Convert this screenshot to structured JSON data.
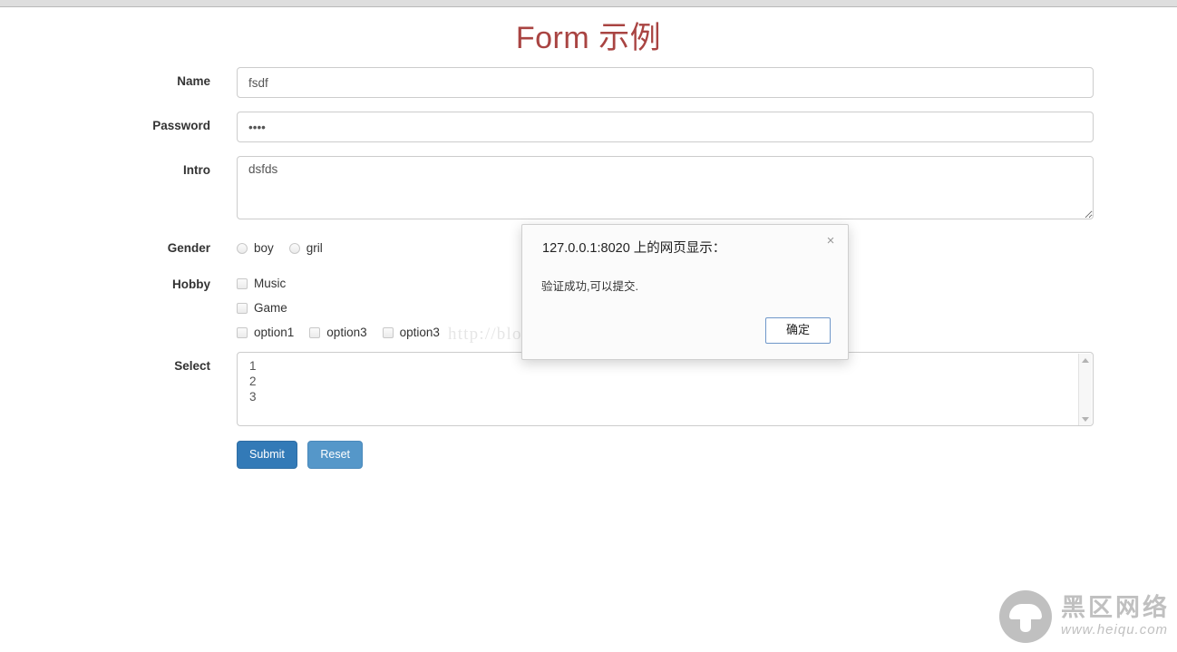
{
  "page": {
    "title": "Form 示例",
    "title_color": "#a94442"
  },
  "form": {
    "fields": [
      {
        "label": "Name",
        "value": "fsdf",
        "placeholder": ""
      },
      {
        "label": "Password",
        "value": "••••",
        "placeholder": ""
      },
      {
        "label": "Intro",
        "value": "dsfds",
        "placeholder": ""
      }
    ],
    "gender": {
      "label": "Gender",
      "options": [
        {
          "label": "boy",
          "checked": false
        },
        {
          "label": "gril",
          "checked": false
        }
      ]
    },
    "hobby": {
      "label": "Hobby",
      "options": [
        {
          "label": "Music",
          "checked": false
        },
        {
          "label": "Game",
          "checked": false
        },
        {
          "label": "option1",
          "checked": false
        },
        {
          "label": "option3",
          "checked": false
        },
        {
          "label": "option3",
          "checked": false
        }
      ]
    },
    "select": {
      "label": "Select",
      "options": [
        "1",
        "2",
        "3"
      ]
    },
    "buttons": {
      "submit": "Submit",
      "reset": "Reset",
      "submit_color": "#337ab7",
      "reset_color": "#5597c9"
    }
  },
  "dialog": {
    "title": "127.0.0.1:8020 上的网页显示：",
    "message": "验证成功,可以提交.",
    "ok_label": "确定",
    "close_label": "×"
  },
  "watermarks": {
    "csdn": "http://blog.csdn.net/zoutongyuan",
    "heiqu_cn": "黑区网络",
    "heiqu_url": "www.heiqu.com"
  }
}
